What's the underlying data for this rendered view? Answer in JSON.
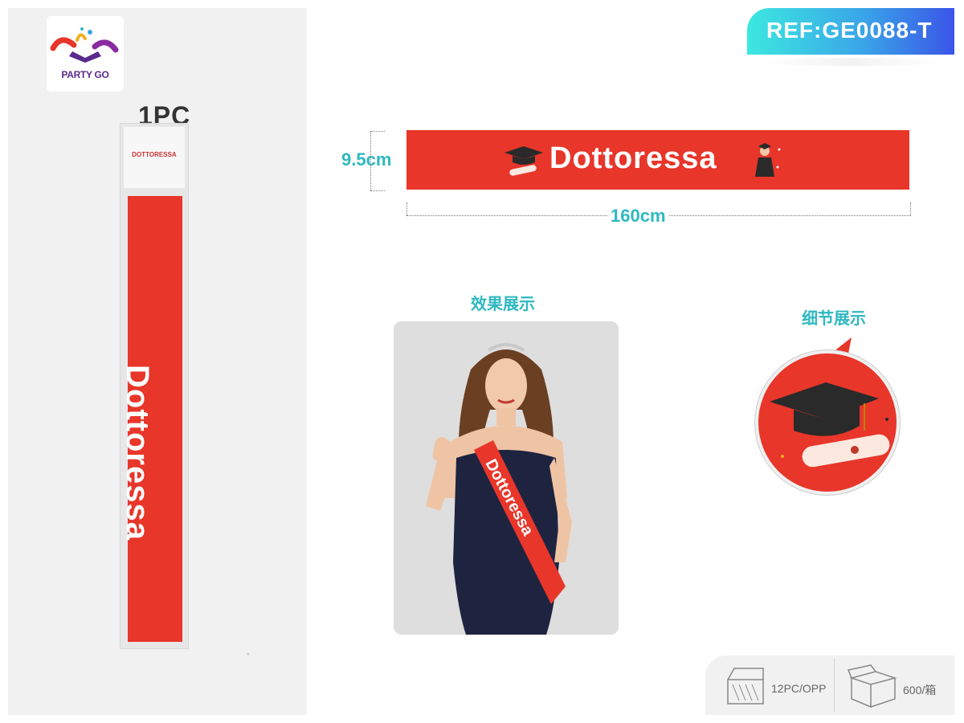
{
  "brand": {
    "logo_text": "PARTY GO"
  },
  "package": {
    "quantity_label": "1PC",
    "header_title": "DOTTORESSA",
    "sash_text": "Dottoressa",
    "footnote": "。"
  },
  "reference": {
    "text": "REF:GE0088-T"
  },
  "sash": {
    "text": "Dottoressa",
    "height_label": "9.5cm",
    "length_label": "160cm",
    "color": "#e8362a"
  },
  "sections": {
    "effect_title": "效果展示",
    "detail_title": "细节展示"
  },
  "photo": {
    "sash_text": "Dottoressa"
  },
  "packing": {
    "inner": "12PC/OPP",
    "outer": "600/箱"
  },
  "colors": {
    "accent": "#2fb8c0",
    "sash_red": "#e8362a",
    "badge_start": "#3ce8e0",
    "badge_end": "#3a55e8"
  }
}
